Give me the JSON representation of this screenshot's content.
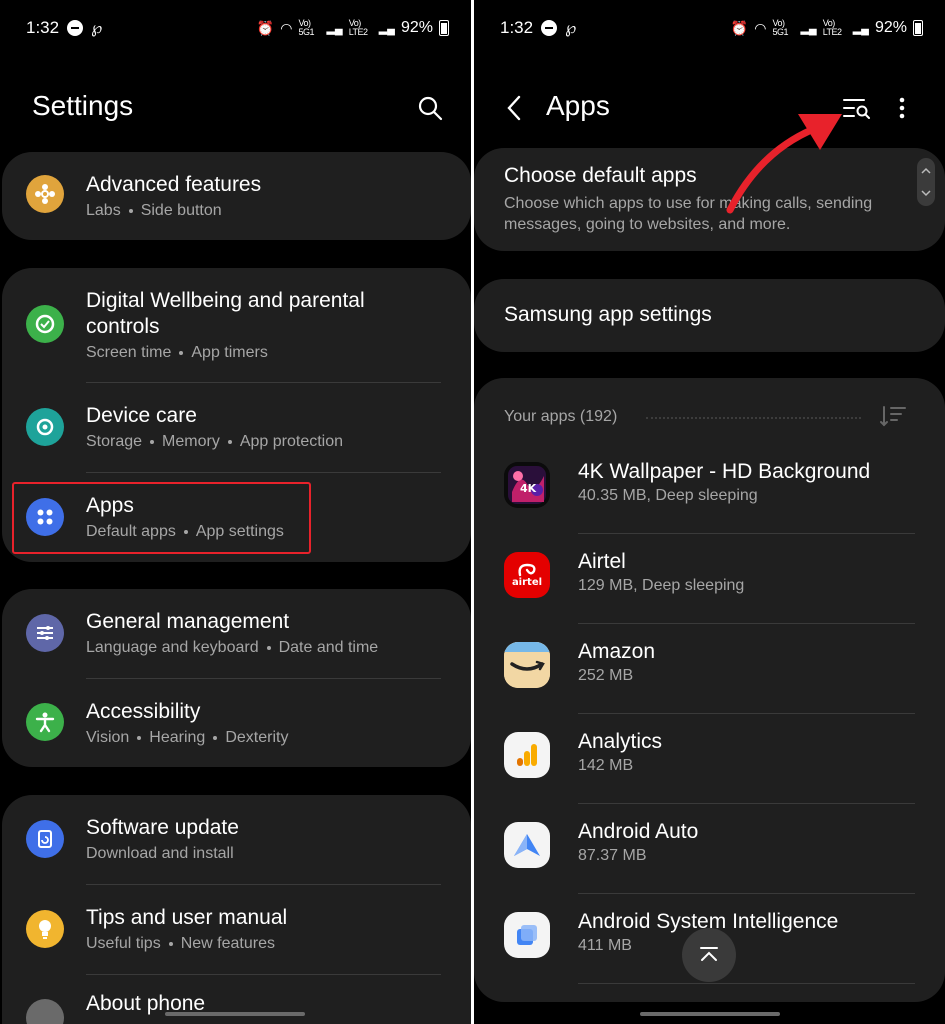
{
  "status": {
    "time": "1:32",
    "battery": "92%",
    "net1": "Vo) 5G1",
    "net2": "Vo) LTE2"
  },
  "left": {
    "title": "Settings",
    "cards": [
      {
        "items": [
          {
            "title": "Advanced features",
            "sub": [
              "Labs",
              "Side button"
            ],
            "icon": "gear-flower-icon",
            "color": "#e0a43c"
          }
        ]
      },
      {
        "items": [
          {
            "title": "Digital Wellbeing and parental controls",
            "title_line1": "Digital Wellbeing and parental",
            "title_line2": "controls",
            "sub": [
              "Screen time",
              "App timers"
            ],
            "icon": "wellbeing-icon",
            "color": "#3cb14a"
          },
          {
            "title": "Device care",
            "sub": [
              "Storage",
              "Memory",
              "App protection"
            ],
            "icon": "device-care-icon",
            "color": "#1ea39a"
          },
          {
            "title": "Apps",
            "sub": [
              "Default apps",
              "App settings"
            ],
            "icon": "apps-grid-icon",
            "color": "#3f6fe8"
          }
        ]
      },
      {
        "items": [
          {
            "title": "General management",
            "sub": [
              "Language and keyboard",
              "Date and time"
            ],
            "icon": "sliders-icon",
            "color": "#5f67a8"
          },
          {
            "title": "Accessibility",
            "sub": [
              "Vision",
              "Hearing",
              "Dexterity"
            ],
            "icon": "accessibility-icon",
            "color": "#3cb14a"
          }
        ]
      },
      {
        "items": [
          {
            "title": "Software update",
            "sub": [
              "Download and install"
            ],
            "icon": "software-update-icon",
            "color": "#3f6fe8"
          },
          {
            "title": "Tips and user manual",
            "sub": [
              "Useful tips",
              "New features"
            ],
            "icon": "lightbulb-icon",
            "color": "#f1b52f"
          },
          {
            "title": "About phone",
            "sub": [],
            "icon": "info-icon",
            "color": "#6a6a6a"
          }
        ]
      }
    ]
  },
  "right": {
    "title": "Apps",
    "default_apps": {
      "title": "Choose default apps",
      "desc_line1": "Choose which apps to use for making calls, sending",
      "desc_line2": "messages, going to websites, and more."
    },
    "samsung_settings": "Samsung app settings",
    "your_apps": "Your apps (192)",
    "apps": [
      {
        "name": "4K Wallpaper - HD Background",
        "info": "40.35 MB, Deep sleeping",
        "icon": "wallpaper-app-icon"
      },
      {
        "name": "Airtel",
        "info": "129 MB, Deep sleeping",
        "icon": "airtel-icon",
        "label": "airtel"
      },
      {
        "name": "Amazon",
        "info": "252 MB",
        "icon": "amazon-icon"
      },
      {
        "name": "Analytics",
        "info": "142 MB",
        "icon": "analytics-icon"
      },
      {
        "name": "Android Auto",
        "info": "87.37 MB",
        "icon": "android-auto-icon"
      },
      {
        "name": "Android System Intelligence",
        "info": "411 MB",
        "icon": "system-intelligence-icon"
      }
    ]
  },
  "colors": {
    "card": "#1f1f1f",
    "background": "#000000",
    "highlight": "#e8222b",
    "arrow": "#e8222b",
    "subtext": "#a6a6a6"
  }
}
